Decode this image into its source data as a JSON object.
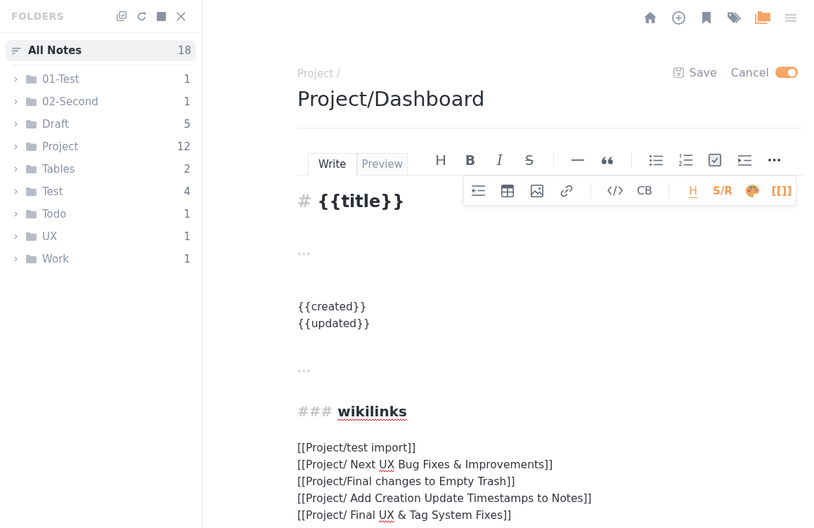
{
  "sidebar": {
    "title": "FOLDERS",
    "all_notes": {
      "label": "All Notes",
      "count": "18",
      "selected": true
    },
    "folders": [
      {
        "name": "01-Test",
        "count": "1",
        "expanded": false,
        "selected": false
      },
      {
        "name": "02-Second",
        "count": "1",
        "expanded": false,
        "selected": false
      },
      {
        "name": "Draft",
        "count": "5",
        "expanded": false,
        "selected": false
      },
      {
        "name": "Project",
        "count": "12",
        "expanded": false,
        "selected": false
      },
      {
        "name": "Tables",
        "count": "2",
        "expanded": false,
        "selected": false
      },
      {
        "name": "Test",
        "count": "4",
        "expanded": false,
        "selected": false
      },
      {
        "name": "Todo",
        "count": "1",
        "expanded": false,
        "selected": false
      },
      {
        "name": "UX",
        "count": "1",
        "expanded": false,
        "selected": false
      },
      {
        "name": "Work",
        "count": "1",
        "expanded": false,
        "selected": false
      }
    ]
  },
  "top_nav": [
    {
      "selected": false
    },
    {
      "selected": false
    },
    {
      "selected": false
    },
    {
      "selected": false
    },
    {
      "selected": true
    },
    {
      "selected": false
    }
  ],
  "note": {
    "breadcrumb": "Project /",
    "title": "Project/Dashboard",
    "save": "Save",
    "cancel": "Cancel",
    "toggle": {
      "on": true
    }
  },
  "editor": {
    "tabs": [
      {
        "label": "Write",
        "selected": true
      },
      {
        "label": "Preview",
        "selected": false
      }
    ],
    "toolbar": {
      "text_buttons": [
        "H",
        "B",
        "I",
        "S"
      ]
    },
    "overflow_menu": {
      "open": true,
      "text_buttons": [
        "CB",
        "H",
        "S/R",
        "[[]]"
      ]
    },
    "content": [
      {
        "kind": "h1",
        "marker": "#",
        "segments": [
          {
            "text": "{{title}}",
            "misspelled": false
          }
        ]
      },
      {
        "kind": "rule",
        "text": "***"
      },
      {
        "kind": "line",
        "segments": [
          {
            "text": "{{created}}",
            "misspelled": false
          }
        ]
      },
      {
        "kind": "line",
        "segments": [
          {
            "text": "{{updated}}",
            "misspelled": false
          }
        ]
      },
      {
        "kind": "rule",
        "text": "***"
      },
      {
        "kind": "h3",
        "marker": "###",
        "segments": [
          {
            "text": "wikilinks",
            "misspelled": true
          }
        ]
      },
      {
        "kind": "line",
        "segments": [
          {
            "text": "[[Project/test import]]",
            "misspelled": false
          }
        ]
      },
      {
        "kind": "line",
        "segments": [
          {
            "text": "[[Project/ Next ",
            "misspelled": false
          },
          {
            "text": "UX",
            "misspelled": true
          },
          {
            "text": " Bug Fixes & Improvements]]",
            "misspelled": false
          }
        ]
      },
      {
        "kind": "line",
        "segments": [
          {
            "text": "[[Project/Final changes to Empty Trash]]",
            "misspelled": false
          }
        ]
      },
      {
        "kind": "line",
        "segments": [
          {
            "text": "[[Project/ Add Creation Update Timestamps to Notes]]",
            "misspelled": false
          }
        ]
      },
      {
        "kind": "line",
        "segments": [
          {
            "text": "[[Project/ Final ",
            "misspelled": false
          },
          {
            "text": "UX",
            "misspelled": true
          },
          {
            "text": " & Tag System Fixes]]",
            "misspelled": false
          }
        ]
      }
    ]
  }
}
